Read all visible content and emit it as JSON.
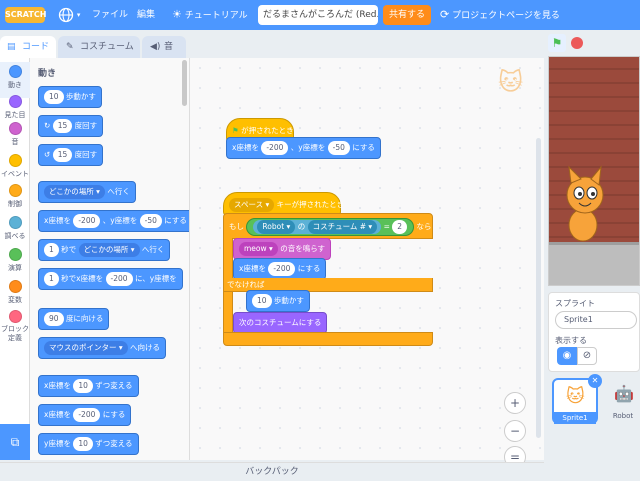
{
  "menubar": {
    "logo": "SCRATCH",
    "globe_icon": "globe-icon",
    "file_label": "ファイル",
    "edit_label": "編集",
    "tutorial_label": "チュートリアル",
    "project_title": "だるまさんがころんだ (Red...",
    "share_label": "共有する",
    "project_page_label": "プロジェクトページを見る"
  },
  "tabs": {
    "code": "コード",
    "costumes": "コスチューム",
    "sounds": "音"
  },
  "categories": [
    {
      "label": "動き",
      "color": "#4c97ff"
    },
    {
      "label": "見た目",
      "color": "#9966ff"
    },
    {
      "label": "音",
      "color": "#cf63cf"
    },
    {
      "label": "イベント",
      "color": "#ffbf00"
    },
    {
      "label": "制御",
      "color": "#ffab19"
    },
    {
      "label": "調べる",
      "color": "#5cb1d6"
    },
    {
      "label": "演算",
      "color": "#59c059"
    },
    {
      "label": "変数",
      "color": "#ff8c1a"
    },
    {
      "label": "ブロック定義",
      "color": "#ff6680"
    }
  ],
  "palette": {
    "heading": "動き",
    "move": {
      "value": "10",
      "suffix": "歩動かす"
    },
    "turn_right": {
      "value": "15",
      "suffix": "度回す"
    },
    "turn_left": {
      "value": "15",
      "suffix": "度回す"
    },
    "goto": {
      "target": "どこかの場所",
      "suffix": "へ行く"
    },
    "goto_xy": {
      "xlabel": "x座標を",
      "x": "-200",
      "ylabel": "、y座標を",
      "y": "-50",
      "suffix": "にする"
    },
    "glide_to": {
      "secs": "1",
      "mid": "秒で",
      "target": "どこかの場所",
      "suffix": "へ行く"
    },
    "glide_xy": {
      "secs": "1",
      "mid": "秒でx座標を",
      "x": "-200",
      "ylabel": "に、y座標を"
    },
    "point_dir": {
      "value": "90",
      "suffix": "度に向ける"
    },
    "point_towards": {
      "target": "マウスのポインター",
      "suffix": "へ向ける"
    },
    "change_x": {
      "prefix": "x座標を",
      "value": "10",
      "suffix": "ずつ変える"
    },
    "set_x": {
      "prefix": "x座標を",
      "value": "-200",
      "suffix": "にする"
    },
    "change_y": {
      "prefix": "y座標を",
      "value": "10",
      "suffix": "ずつ変える"
    }
  },
  "script": {
    "hat1": "が押されたとき",
    "s1_xlabel": "x座標を",
    "s1_x": "-200",
    "s1_ylabel": "、y座標を",
    "s1_y": "-50",
    "s1_suffix": "にする",
    "hat2_key": "スペース",
    "hat2_suffix": "キーが押されたとき",
    "if_label": "もし",
    "if_sprite": "Robot",
    "if_of": "の",
    "if_prop": "コスチューム #",
    "if_eq": "=",
    "if_value": "2",
    "if_then": "なら",
    "sound_name": "meow",
    "sound_suffix": "の音を鳴らす",
    "setx_prefix": "x座標を",
    "setx_value": "-200",
    "setx_suffix": "にする",
    "else_label": "でなければ",
    "move_value": "10",
    "move_suffix": "歩動かす",
    "next_costume": "次のコスチュームにする"
  },
  "zoom": {
    "in": "+",
    "out": "−",
    "reset": "="
  },
  "sprite_info": {
    "label": "スプライト",
    "name": "Sprite1",
    "show_label": "表示する"
  },
  "sprites": [
    {
      "name": "Sprite1",
      "selected": true
    },
    {
      "name": "Robot",
      "selected": false
    }
  ],
  "backpack": "バックパック"
}
